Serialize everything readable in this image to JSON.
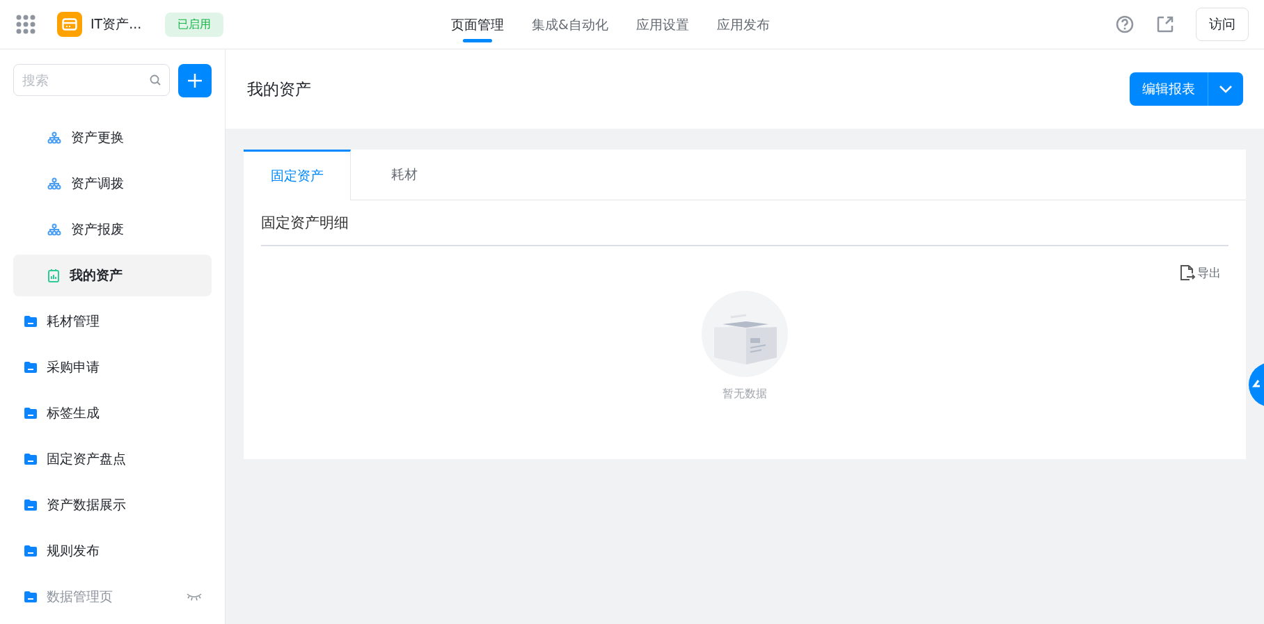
{
  "app": {
    "name": "IT资产...",
    "status": "已启用"
  },
  "nav_tabs": [
    {
      "label": "页面管理",
      "selected": true
    },
    {
      "label": "集成&自动化",
      "selected": false
    },
    {
      "label": "应用设置",
      "selected": false
    },
    {
      "label": "应用发布",
      "selected": false
    }
  ],
  "visit_button": "访问",
  "sidebar": {
    "search": {
      "placeholder": "搜索"
    },
    "items": [
      {
        "label": "资产更换",
        "kind": "page",
        "indent": true,
        "selected": false,
        "hidden": false
      },
      {
        "label": "资产调拨",
        "kind": "page",
        "indent": true,
        "selected": false,
        "hidden": false
      },
      {
        "label": "资产报废",
        "kind": "page",
        "indent": true,
        "selected": false,
        "hidden": false
      },
      {
        "label": "我的资产",
        "kind": "report",
        "indent": true,
        "selected": true,
        "hidden": false
      },
      {
        "label": "耗材管理",
        "kind": "folder",
        "indent": false,
        "selected": false,
        "hidden": false
      },
      {
        "label": "采购申请",
        "kind": "folder",
        "indent": false,
        "selected": false,
        "hidden": false
      },
      {
        "label": "标签生成",
        "kind": "folder",
        "indent": false,
        "selected": false,
        "hidden": false
      },
      {
        "label": "固定资产盘点",
        "kind": "folder",
        "indent": false,
        "selected": false,
        "hidden": false
      },
      {
        "label": "资产数据展示",
        "kind": "folder",
        "indent": false,
        "selected": false,
        "hidden": false
      },
      {
        "label": "规则发布",
        "kind": "folder",
        "indent": false,
        "selected": false,
        "hidden": false
      },
      {
        "label": "数据管理页",
        "kind": "folder",
        "indent": false,
        "selected": false,
        "hidden": true
      }
    ]
  },
  "page": {
    "title": "我的资产",
    "edit_button": "编辑报表",
    "tabs": [
      {
        "label": "固定资产",
        "selected": true
      },
      {
        "label": "耗材",
        "selected": false
      }
    ],
    "section_title": "固定资产明细",
    "export": "导出",
    "empty_text": "暂无数据"
  }
}
